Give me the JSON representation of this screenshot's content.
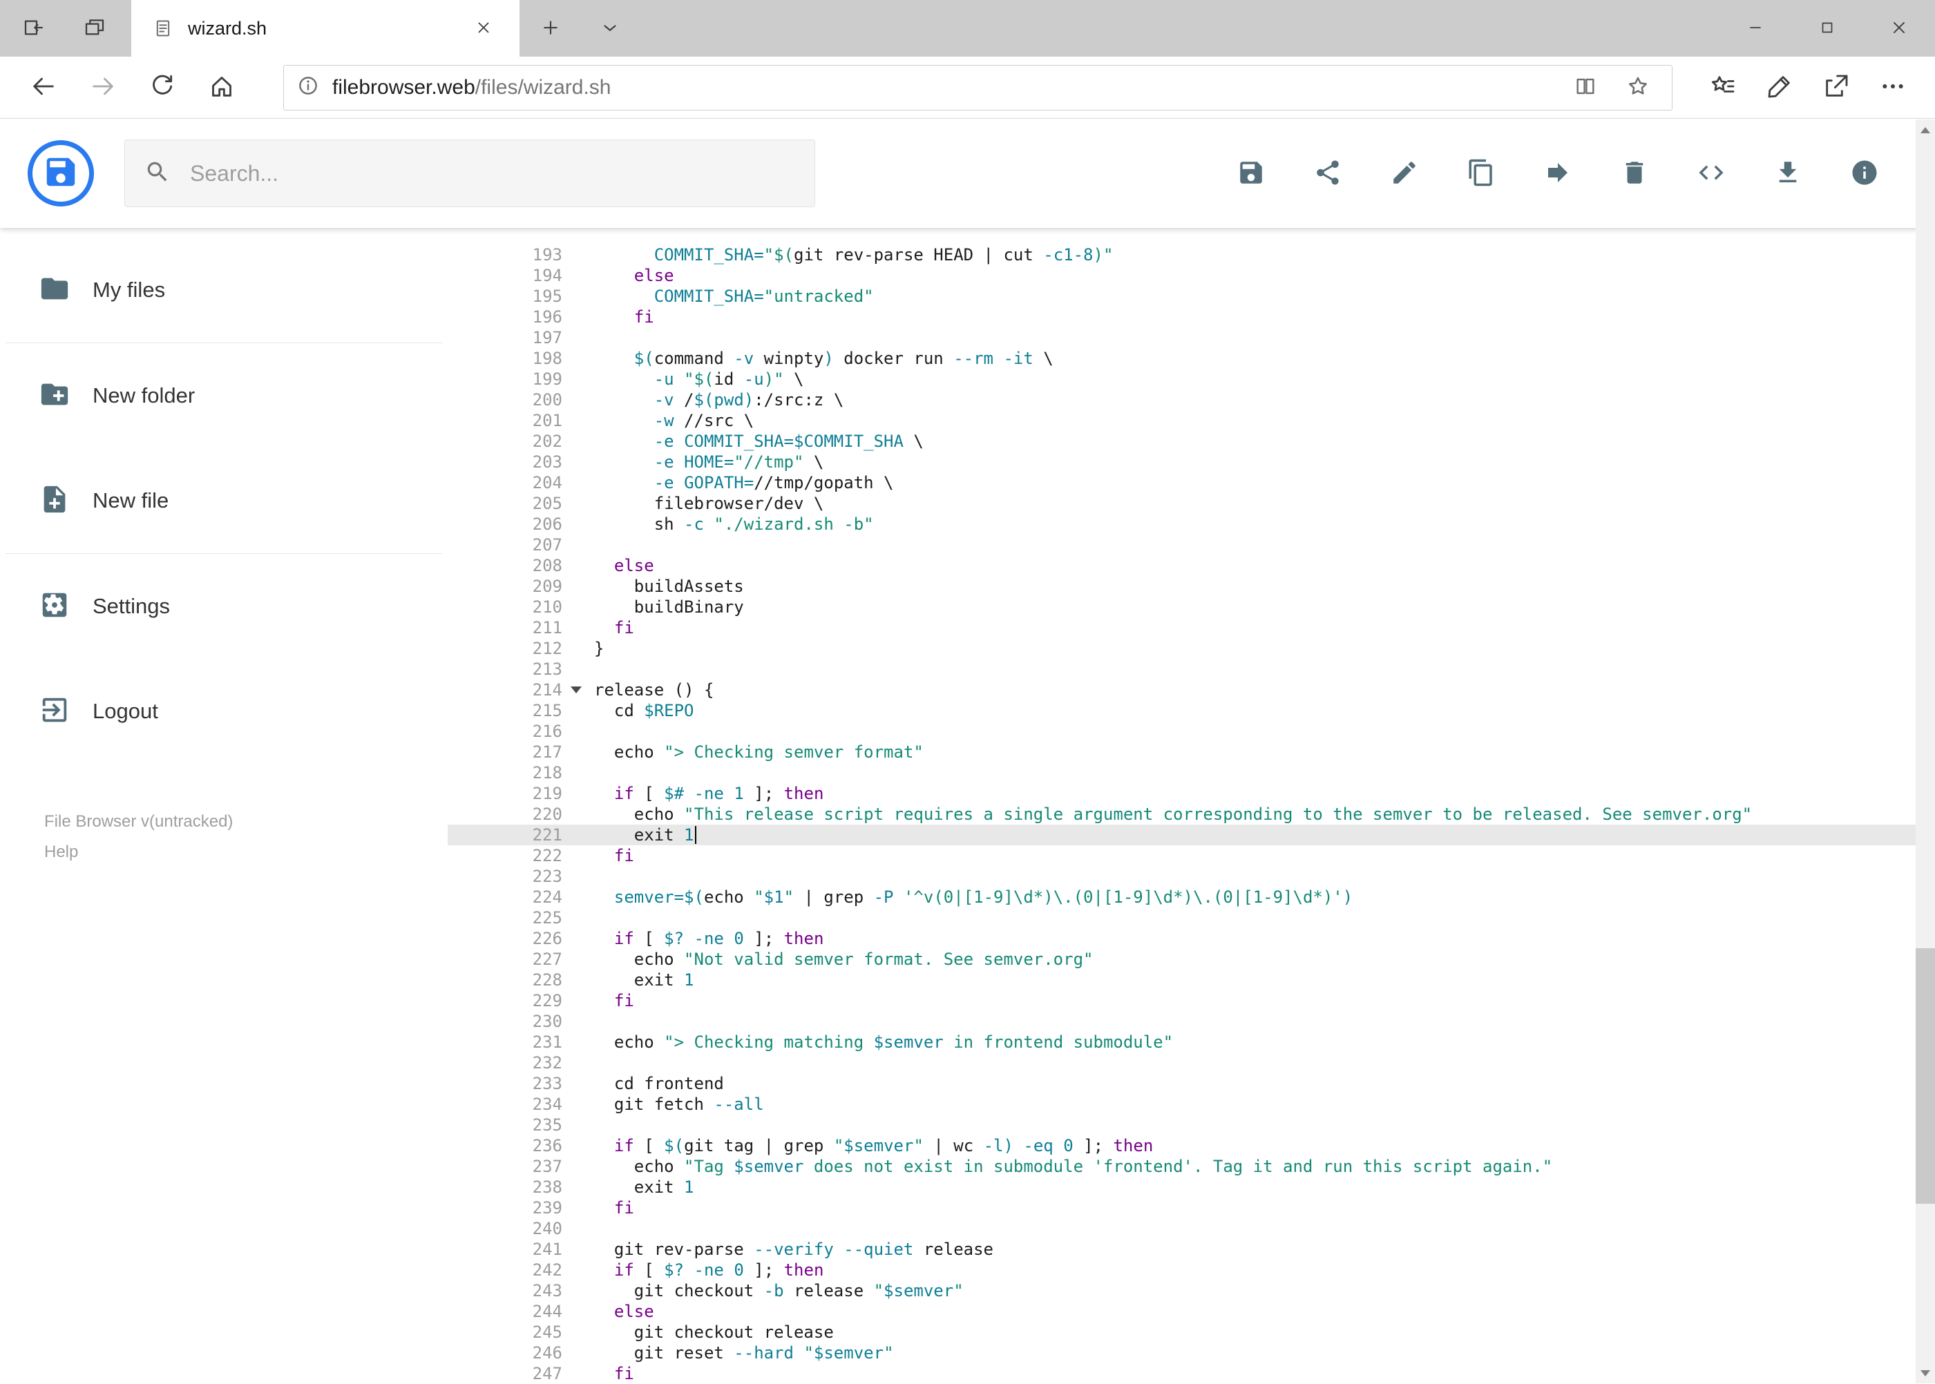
{
  "browser": {
    "tab_title": "wizard.sh",
    "url_host": "filebrowser.web",
    "url_path": "/files/wizard.sh"
  },
  "header": {
    "search_placeholder": "Search...",
    "toolbar": [
      {
        "icon": "save",
        "name": "save-button"
      },
      {
        "icon": "share",
        "name": "share-button"
      },
      {
        "icon": "edit",
        "name": "edit-button"
      },
      {
        "icon": "copy",
        "name": "copy-button"
      },
      {
        "icon": "move",
        "name": "move-button"
      },
      {
        "icon": "delete",
        "name": "delete-button"
      },
      {
        "icon": "code",
        "name": "code-view-button"
      },
      {
        "icon": "download",
        "name": "download-button"
      },
      {
        "icon": "info",
        "name": "info-button"
      }
    ]
  },
  "sidebar": {
    "items": [
      {
        "label": "My files",
        "icon": "folder",
        "name": "sidebar-item-my-files"
      },
      {
        "label": "New folder",
        "icon": "new-folder",
        "name": "sidebar-item-new-folder"
      },
      {
        "label": "New file",
        "icon": "new-file",
        "name": "sidebar-item-new-file"
      },
      {
        "label": "Settings",
        "icon": "settings",
        "name": "sidebar-item-settings"
      },
      {
        "label": "Logout",
        "icon": "logout",
        "name": "sidebar-item-logout"
      }
    ],
    "dividers_after": [
      0,
      2
    ],
    "footer_version": "File Browser v(untracked)",
    "footer_help": "Help"
  },
  "editor": {
    "lines": [
      {
        "n": 193,
        "seg": [
          [
            "p",
            "      "
          ],
          [
            "v",
            "COMMIT_SHA="
          ],
          [
            "s",
            "\"$("
          ],
          [
            "p",
            "git rev-parse HEAD | cut "
          ],
          [
            "n",
            "-c1-8"
          ],
          [
            "s",
            ")\""
          ]
        ]
      },
      {
        "n": 194,
        "seg": [
          [
            "p",
            "    "
          ],
          [
            "k",
            "else"
          ]
        ]
      },
      {
        "n": 195,
        "seg": [
          [
            "p",
            "      "
          ],
          [
            "v",
            "COMMIT_SHA="
          ],
          [
            "s",
            "\"untracked\""
          ]
        ]
      },
      {
        "n": 196,
        "seg": [
          [
            "p",
            "    "
          ],
          [
            "k",
            "fi"
          ]
        ]
      },
      {
        "n": 197,
        "seg": []
      },
      {
        "n": 198,
        "seg": [
          [
            "p",
            "    "
          ],
          [
            "v",
            "$("
          ],
          [
            "p",
            "command "
          ],
          [
            "n",
            "-v"
          ],
          [
            "p",
            " winpty"
          ],
          [
            "v",
            ")"
          ],
          [
            "p",
            " docker run "
          ],
          [
            "n",
            "--rm"
          ],
          [
            "p",
            " "
          ],
          [
            "n",
            "-it"
          ],
          [
            "p",
            " \\"
          ]
        ]
      },
      {
        "n": 199,
        "seg": [
          [
            "p",
            "      "
          ],
          [
            "n",
            "-u"
          ],
          [
            "p",
            " "
          ],
          [
            "s",
            "\"$("
          ],
          [
            "p",
            "id "
          ],
          [
            "n",
            "-u"
          ],
          [
            "s",
            ")\""
          ],
          [
            "p",
            " \\"
          ]
        ]
      },
      {
        "n": 200,
        "seg": [
          [
            "p",
            "      "
          ],
          [
            "n",
            "-v"
          ],
          [
            "p",
            " /"
          ],
          [
            "v",
            "$(pwd)"
          ],
          [
            "p",
            ":/src:z \\"
          ]
        ]
      },
      {
        "n": 201,
        "seg": [
          [
            "p",
            "      "
          ],
          [
            "n",
            "-w"
          ],
          [
            "p",
            " //src \\"
          ]
        ]
      },
      {
        "n": 202,
        "seg": [
          [
            "p",
            "      "
          ],
          [
            "n",
            "-e"
          ],
          [
            "p",
            " "
          ],
          [
            "v",
            "COMMIT_SHA=$COMMIT_SHA"
          ],
          [
            "p",
            " \\"
          ]
        ]
      },
      {
        "n": 203,
        "seg": [
          [
            "p",
            "      "
          ],
          [
            "n",
            "-e"
          ],
          [
            "p",
            " "
          ],
          [
            "v",
            "HOME="
          ],
          [
            "s",
            "\"//tmp\""
          ],
          [
            "p",
            " \\"
          ]
        ]
      },
      {
        "n": 204,
        "seg": [
          [
            "p",
            "      "
          ],
          [
            "n",
            "-e"
          ],
          [
            "p",
            " "
          ],
          [
            "v",
            "GOPATH="
          ],
          [
            "p",
            "//tmp/gopath \\"
          ]
        ]
      },
      {
        "n": 205,
        "seg": [
          [
            "p",
            "      filebrowser/dev \\"
          ]
        ]
      },
      {
        "n": 206,
        "seg": [
          [
            "p",
            "      sh "
          ],
          [
            "n",
            "-c"
          ],
          [
            "p",
            " "
          ],
          [
            "s",
            "\"./wizard.sh -b\""
          ]
        ]
      },
      {
        "n": 207,
        "seg": []
      },
      {
        "n": 208,
        "seg": [
          [
            "p",
            "  "
          ],
          [
            "k",
            "else"
          ]
        ]
      },
      {
        "n": 209,
        "seg": [
          [
            "p",
            "    buildAssets"
          ]
        ]
      },
      {
        "n": 210,
        "seg": [
          [
            "p",
            "    buildBinary"
          ]
        ]
      },
      {
        "n": 211,
        "seg": [
          [
            "p",
            "  "
          ],
          [
            "k",
            "fi"
          ]
        ]
      },
      {
        "n": 212,
        "seg": [
          [
            "p",
            "}"
          ]
        ]
      },
      {
        "n": 213,
        "seg": []
      },
      {
        "n": 214,
        "fold": true,
        "seg": [
          [
            "p",
            "release () {"
          ]
        ]
      },
      {
        "n": 215,
        "seg": [
          [
            "p",
            "  cd "
          ],
          [
            "v",
            "$REPO"
          ]
        ]
      },
      {
        "n": 216,
        "seg": []
      },
      {
        "n": 217,
        "seg": [
          [
            "p",
            "  echo "
          ],
          [
            "s",
            "\"> Checking semver format\""
          ]
        ]
      },
      {
        "n": 218,
        "seg": []
      },
      {
        "n": 219,
        "seg": [
          [
            "p",
            "  "
          ],
          [
            "k",
            "if"
          ],
          [
            "p",
            " [ "
          ],
          [
            "v",
            "$#"
          ],
          [
            "p",
            " "
          ],
          [
            "n",
            "-ne"
          ],
          [
            "p",
            " "
          ],
          [
            "n",
            "1"
          ],
          [
            "p",
            " ]; "
          ],
          [
            "k",
            "then"
          ]
        ]
      },
      {
        "n": 220,
        "seg": [
          [
            "p",
            "    echo "
          ],
          [
            "s",
            "\"This release script requires a single argument corresponding to the semver to be released. See semver.org\""
          ]
        ]
      },
      {
        "n": 221,
        "active": true,
        "cursor": true,
        "seg": [
          [
            "p",
            "    exit "
          ],
          [
            "n",
            "1"
          ]
        ]
      },
      {
        "n": 222,
        "seg": [
          [
            "p",
            "  "
          ],
          [
            "k",
            "fi"
          ]
        ]
      },
      {
        "n": 223,
        "seg": []
      },
      {
        "n": 224,
        "seg": [
          [
            "p",
            "  "
          ],
          [
            "v",
            "semver=$("
          ],
          [
            "p",
            "echo "
          ],
          [
            "s",
            "\""
          ],
          [
            "v",
            "$1"
          ],
          [
            "s",
            "\""
          ],
          [
            "p",
            " | grep "
          ],
          [
            "n",
            "-P"
          ],
          [
            "p",
            " "
          ],
          [
            "s",
            "'^v(0|[1-9]\\d*)\\.(0|[1-9]\\d*)\\.(0|[1-9]\\d*)'"
          ],
          [
            "v",
            ")"
          ]
        ]
      },
      {
        "n": 225,
        "seg": []
      },
      {
        "n": 226,
        "seg": [
          [
            "p",
            "  "
          ],
          [
            "k",
            "if"
          ],
          [
            "p",
            " [ "
          ],
          [
            "v",
            "$?"
          ],
          [
            "p",
            " "
          ],
          [
            "n",
            "-ne"
          ],
          [
            "p",
            " "
          ],
          [
            "n",
            "0"
          ],
          [
            "p",
            " ]; "
          ],
          [
            "k",
            "then"
          ]
        ]
      },
      {
        "n": 227,
        "seg": [
          [
            "p",
            "    echo "
          ],
          [
            "s",
            "\"Not valid semver format. See semver.org\""
          ]
        ]
      },
      {
        "n": 228,
        "seg": [
          [
            "p",
            "    exit "
          ],
          [
            "n",
            "1"
          ]
        ]
      },
      {
        "n": 229,
        "seg": [
          [
            "p",
            "  "
          ],
          [
            "k",
            "fi"
          ]
        ]
      },
      {
        "n": 230,
        "seg": []
      },
      {
        "n": 231,
        "seg": [
          [
            "p",
            "  echo "
          ],
          [
            "s",
            "\"> Checking matching "
          ],
          [
            "v",
            "$semver"
          ],
          [
            "s",
            " in frontend submodule\""
          ]
        ]
      },
      {
        "n": 232,
        "seg": []
      },
      {
        "n": 233,
        "seg": [
          [
            "p",
            "  cd frontend"
          ]
        ]
      },
      {
        "n": 234,
        "seg": [
          [
            "p",
            "  git fetch "
          ],
          [
            "n",
            "--all"
          ]
        ]
      },
      {
        "n": 235,
        "seg": []
      },
      {
        "n": 236,
        "seg": [
          [
            "p",
            "  "
          ],
          [
            "k",
            "if"
          ],
          [
            "p",
            " [ "
          ],
          [
            "v",
            "$("
          ],
          [
            "p",
            "git tag | grep "
          ],
          [
            "s",
            "\""
          ],
          [
            "v",
            "$semver"
          ],
          [
            "s",
            "\""
          ],
          [
            "p",
            " | wc "
          ],
          [
            "n",
            "-l"
          ],
          [
            "v",
            ")"
          ],
          [
            "p",
            " "
          ],
          [
            "n",
            "-eq"
          ],
          [
            "p",
            " "
          ],
          [
            "n",
            "0"
          ],
          [
            "p",
            " ]; "
          ],
          [
            "k",
            "then"
          ]
        ]
      },
      {
        "n": 237,
        "seg": [
          [
            "p",
            "    echo "
          ],
          [
            "s",
            "\"Tag "
          ],
          [
            "v",
            "$semver"
          ],
          [
            "s",
            " does not exist in submodule 'frontend'. Tag it and run this script again.\""
          ]
        ]
      },
      {
        "n": 238,
        "seg": [
          [
            "p",
            "    exit "
          ],
          [
            "n",
            "1"
          ]
        ]
      },
      {
        "n": 239,
        "seg": [
          [
            "p",
            "  "
          ],
          [
            "k",
            "fi"
          ]
        ]
      },
      {
        "n": 240,
        "seg": []
      },
      {
        "n": 241,
        "seg": [
          [
            "p",
            "  git rev-parse "
          ],
          [
            "n",
            "--verify"
          ],
          [
            "p",
            " "
          ],
          [
            "n",
            "--quiet"
          ],
          [
            "p",
            " release"
          ]
        ]
      },
      {
        "n": 242,
        "seg": [
          [
            "p",
            "  "
          ],
          [
            "k",
            "if"
          ],
          [
            "p",
            " [ "
          ],
          [
            "v",
            "$?"
          ],
          [
            "p",
            " "
          ],
          [
            "n",
            "-ne"
          ],
          [
            "p",
            " "
          ],
          [
            "n",
            "0"
          ],
          [
            "p",
            " ]; "
          ],
          [
            "k",
            "then"
          ]
        ]
      },
      {
        "n": 243,
        "seg": [
          [
            "p",
            "    git checkout "
          ],
          [
            "n",
            "-b"
          ],
          [
            "p",
            " release "
          ],
          [
            "s",
            "\""
          ],
          [
            "v",
            "$semver"
          ],
          [
            "s",
            "\""
          ]
        ]
      },
      {
        "n": 244,
        "seg": [
          [
            "p",
            "  "
          ],
          [
            "k",
            "else"
          ]
        ]
      },
      {
        "n": 245,
        "seg": [
          [
            "p",
            "    git checkout release"
          ]
        ]
      },
      {
        "n": 246,
        "seg": [
          [
            "p",
            "    git reset "
          ],
          [
            "n",
            "--hard"
          ],
          [
            "p",
            " "
          ],
          [
            "s",
            "\""
          ],
          [
            "v",
            "$semver"
          ],
          [
            "s",
            "\""
          ]
        ]
      },
      {
        "n": 247,
        "seg": [
          [
            "p",
            "  "
          ],
          [
            "k",
            "fi"
          ]
        ]
      }
    ]
  },
  "colors": {
    "accent": "#2a7af0",
    "keyword": "#770088",
    "string": "#158a76",
    "variable": "#0e7f95",
    "line_number": "#9c9c9c",
    "active_line": "#e8e8e8",
    "icon_gray": "#546e7a"
  }
}
